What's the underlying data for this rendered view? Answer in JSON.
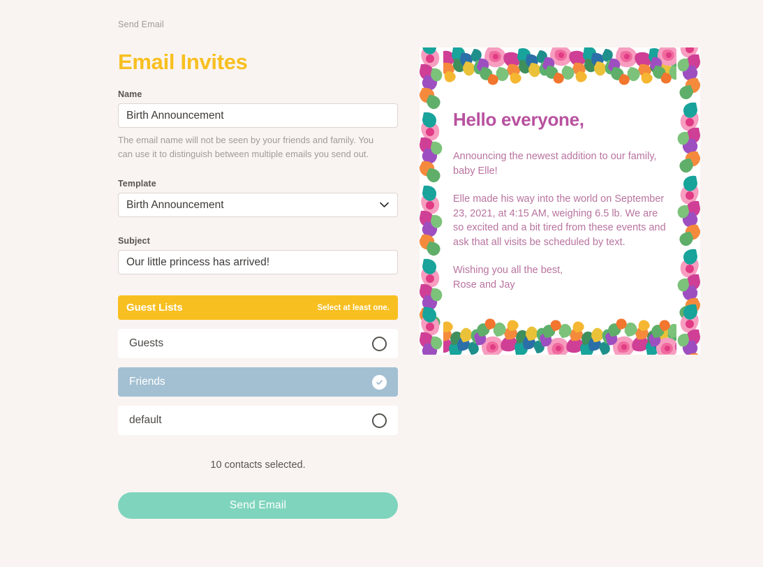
{
  "breadcrumb": "Send Email",
  "page_title": "Email Invites",
  "colors": {
    "page_background": "#f9f4f1",
    "accent_yellow": "#f8bf20",
    "selected_row_blue": "#a3c0d2",
    "send_button_mint": "#7fd4bd",
    "preview_heading_magenta": "#b8519f",
    "preview_text_mauve": "#b8739f"
  },
  "form": {
    "name": {
      "label": "Name",
      "value": "Birth Announcement",
      "placeholder": "Name",
      "helper": "The email name will not be seen by your friends and family. You can use it to distinguish between multiple emails you send out."
    },
    "template": {
      "label": "Template",
      "value": "Birth Announcement",
      "options": [
        "Birth Announcement"
      ]
    },
    "subject": {
      "label": "Subject",
      "value": "Our little princess has arrived!",
      "placeholder": "Subject"
    }
  },
  "guest_lists": {
    "header_title": "Guest Lists",
    "header_hint": "Select at least one.",
    "rows": [
      {
        "label": "Guests",
        "selected": false
      },
      {
        "label": "Friends",
        "selected": true
      },
      {
        "label": "default",
        "selected": false
      }
    ]
  },
  "footer": {
    "contacts_selected": "10 contacts selected.",
    "send_label": "Send Email"
  },
  "preview": {
    "heading": "Hello everyone,",
    "paragraphs": [
      "Announcing the newest addition to our family, baby Elle!",
      "Elle made his way into the world on September 23, 2021, at 4:15 AM, weighing 6.5 lb. We are so excited and a bit tired from these events and ask that all visits be scheduled by text.",
      "Wishing you all the best,\nRose and Jay"
    ]
  }
}
